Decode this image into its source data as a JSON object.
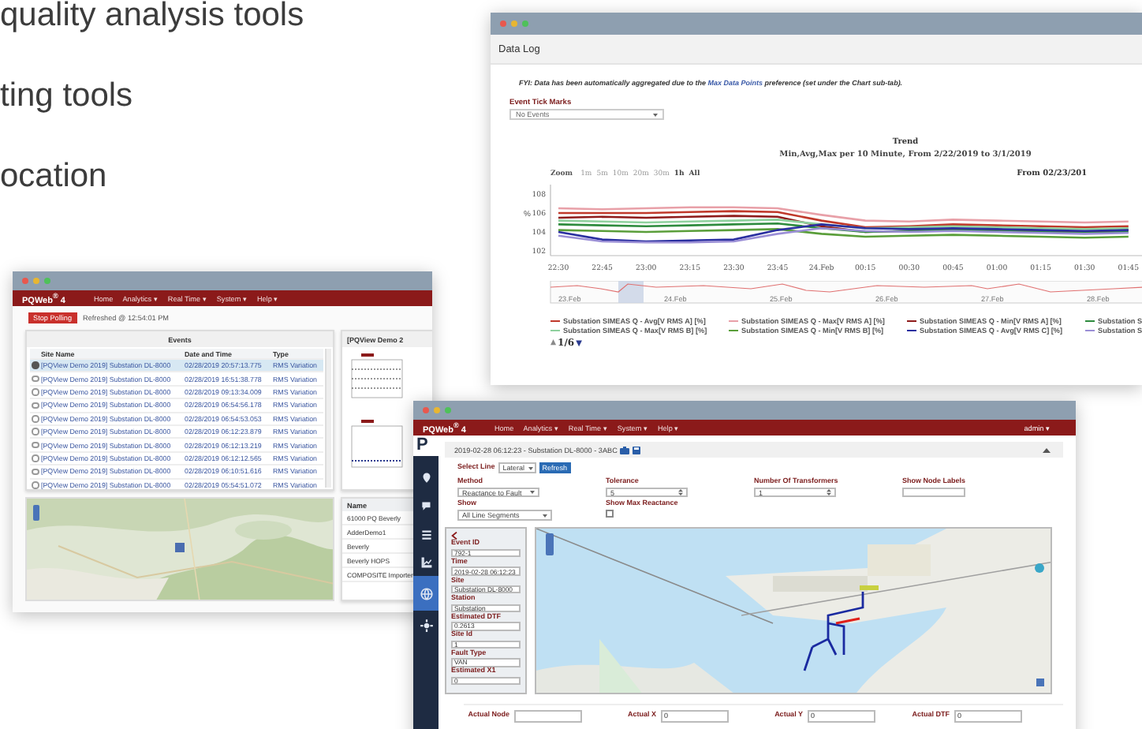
{
  "intro_lines": [
    "quality analysis tools",
    "ting tools",
    "ocation"
  ],
  "data_log": {
    "title": "Data Log",
    "notice": {
      "before": "FYI: Data has been automatically aggregated due to the ",
      "link": "Max Data Points",
      "after": " preference (set under the Chart sub-tab)."
    },
    "tick_marks": {
      "label": "Event Tick Marks",
      "value": "No Events"
    },
    "chart_title": "Trend",
    "chart_subtitle": "Min,Avg,Max per 10 Minute, From 2/22/2019 to 3/1/2019",
    "zoom_label": "Zoom",
    "zoom_options": [
      {
        "label": "1m",
        "disabled": true
      },
      {
        "label": "5m",
        "disabled": true
      },
      {
        "label": "10m",
        "disabled": true
      },
      {
        "label": "20m",
        "disabled": true
      },
      {
        "label": "30m",
        "disabled": true
      },
      {
        "label": "1h",
        "disabled": false
      },
      {
        "label": "All",
        "disabled": false
      }
    ],
    "range_from": "From 02/23/201",
    "chart_data": {
      "type": "line",
      "ylabel": "%",
      "categories": [
        "22:30",
        "22:45",
        "23:00",
        "23:15",
        "23:30",
        "23:45",
        "24.Feb",
        "00:15",
        "00:30",
        "00:45",
        "01:00",
        "01:15",
        "01:30",
        "01:45"
      ],
      "yticks": [
        102,
        104,
        106,
        108
      ],
      "ylim": [
        101.5,
        109
      ],
      "series": [
        {
          "name": "Substation SIMEAS Q - Avg[V RMS A] [%]",
          "color": "#c0392b",
          "values": [
            106,
            106,
            106,
            106.1,
            106.2,
            106.1,
            105.2,
            104.5,
            104.6,
            104.8,
            104.7,
            104.6,
            104.5,
            104.6
          ]
        },
        {
          "name": "Substation SIMEAS Q - Max[V RMS A] [%]",
          "color": "#e8a0a8",
          "values": [
            106.5,
            106.4,
            106.5,
            106.6,
            106.6,
            106.5,
            105.8,
            105.2,
            105.1,
            105.3,
            105.2,
            105.1,
            105,
            105.1
          ]
        },
        {
          "name": "Substation SIMEAS Q - Min[V RMS A] [%]",
          "color": "#8e1b1b",
          "values": [
            105.5,
            105.6,
            105.5,
            105.6,
            105.7,
            105.6,
            104.6,
            104,
            104.1,
            104.3,
            104.2,
            104.1,
            104,
            104.2
          ]
        },
        {
          "name": "Substation S",
          "color": "#2e8b3e",
          "values": [
            104.8,
            104.7,
            104.6,
            104.7,
            104.8,
            104.9,
            104.4,
            104,
            104.1,
            104.2,
            104.1,
            104,
            103.9,
            104
          ]
        },
        {
          "name": "Substation SIMEAS Q - Max[V RMS B] [%]",
          "color": "#8fd19e",
          "values": [
            105.2,
            105.1,
            105,
            105.1,
            105.2,
            105.3,
            104.8,
            104.4,
            104.5,
            104.6,
            104.5,
            104.4,
            104.3,
            104.4
          ]
        },
        {
          "name": "Substation SIMEAS Q - Min[V RMS B] [%]",
          "color": "#5a9e3a",
          "values": [
            104.2,
            104.1,
            104,
            104.1,
            104.2,
            104.3,
            103.8,
            103.5,
            103.6,
            103.7,
            103.6,
            103.5,
            103.4,
            103.5
          ]
        },
        {
          "name": "Substation SIMEAS Q - Avg[V RMS C] [%]",
          "color": "#2a2fa0",
          "values": [
            104,
            103.2,
            103,
            103.1,
            103.2,
            104.2,
            104.8,
            104.4,
            104.3,
            104.4,
            104.3,
            104.2,
            104.1,
            104.2
          ]
        },
        {
          "name": "Substation S",
          "color": "#9b8fd6",
          "values": [
            103.6,
            103,
            102.9,
            102.9,
            103,
            103.8,
            104.4,
            104.1,
            104,
            104.1,
            104,
            103.9,
            103.8,
            103.9
          ]
        }
      ]
    },
    "navigator_labels": [
      "23.Feb",
      "24.Feb",
      "25.Feb",
      "26.Feb",
      "27.Feb",
      "28.Feb"
    ],
    "legend_pager": {
      "up": "▲",
      "up_disabled": true,
      "page": "1/6",
      "down": "▼"
    }
  },
  "events_app": {
    "brand": "PQWeb$^{®}$ 4",
    "menu": [
      "Home",
      "Analytics ▾",
      "Real Time ▾",
      "System ▾",
      "Help ▾"
    ],
    "stop_button": "Stop Polling",
    "refreshed": "Refreshed @ 12:54:01 PM",
    "events_panel": {
      "title": "Events",
      "columns": [
        "Site Name",
        "Date and Time",
        "Type"
      ],
      "rows": [
        {
          "selected": true,
          "site": "[PQView Demo 2019] Substation DL-8000",
          "time": "02/28/2019 20:57:13.775",
          "type": "RMS Variation"
        },
        {
          "selected": false,
          "site": "[PQView Demo 2019] Substation DL-8000",
          "time": "02/28/2019 16:51:38.778",
          "type": "RMS Variation"
        },
        {
          "selected": false,
          "site": "[PQView Demo 2019] Substation DL-8000",
          "time": "02/28/2019 09:13:34.009",
          "type": "RMS Variation"
        },
        {
          "selected": false,
          "site": "[PQView Demo 2019] Substation DL-8000",
          "time": "02/28/2019 06:54:56.178",
          "type": "RMS Variation"
        },
        {
          "selected": false,
          "site": "[PQView Demo 2019] Substation DL-8000",
          "time": "02/28/2019 06:54:53.053",
          "type": "RMS Variation"
        },
        {
          "selected": false,
          "site": "[PQView Demo 2019] Substation DL-8000",
          "time": "02/28/2019 06:12:23.879",
          "type": "RMS Variation"
        },
        {
          "selected": false,
          "site": "[PQView Demo 2019] Substation DL-8000",
          "time": "02/28/2019 06:12:13.219",
          "type": "RMS Variation"
        },
        {
          "selected": false,
          "site": "[PQView Demo 2019] Substation DL-8000",
          "time": "02/28/2019 06:12:12.565",
          "type": "RMS Variation"
        },
        {
          "selected": false,
          "site": "[PQView Demo 2019] Substation DL-8000",
          "time": "02/28/2019 06:10:51.616",
          "type": "RMS Variation"
        },
        {
          "selected": false,
          "site": "[PQView Demo 2019] Substation DL-8000",
          "time": "02/28/2019 05:54:51.072",
          "type": "RMS Variation"
        }
      ]
    },
    "detail_title": "[PQView Demo 2",
    "sites_panel": {
      "column": "Name",
      "rows": [
        "61000 PQ Beverly",
        "AdderDemo1",
        "Beverly",
        "Beverly HOPS",
        "COMPOSITE Importer"
      ]
    }
  },
  "fault_app": {
    "brand": "PQWeb$^{®}$ 4",
    "menu": [
      "Home",
      "Analytics ▾",
      "Real Time ▾",
      "System ▾",
      "Help ▾"
    ],
    "user": "admin ▾",
    "logo": "P",
    "sidebar": [
      {
        "selected": false
      },
      {
        "selected": false
      },
      {
        "selected": false
      },
      {
        "selected": false
      },
      {
        "selected": true
      },
      {
        "selected": false
      }
    ],
    "breadcrumb": "2019-02-28 06:12:23 - Substation DL-8000 - 3ABC",
    "select_line": {
      "label": "Select Line",
      "value": "Lateral",
      "button": "Refresh"
    },
    "options": [
      {
        "label": "Method",
        "kind": "select",
        "value": "Reactance to Fault"
      },
      {
        "label": "Tolerance",
        "kind": "spinner",
        "value": "5"
      },
      {
        "label": "Number Of Transformers",
        "kind": "spinner",
        "value": "1"
      },
      {
        "label": "Show Node Labels",
        "kind": "text"
      },
      {
        "label": "Show",
        "kind": "select",
        "value": "All Line Segments"
      },
      {
        "label": "Show Max Reactance",
        "kind": "checkbox",
        "checked": false
      }
    ],
    "event_fields": [
      {
        "label": "Event ID",
        "value": "792-1"
      },
      {
        "label": "Time",
        "value": "2019-02-28 06:12:23"
      },
      {
        "label": "Site",
        "value": "Substation DL-8000"
      },
      {
        "label": "Station",
        "value": "Substation"
      },
      {
        "label": "Estimated DTF",
        "value": "0.2613"
      },
      {
        "label": "Site Id",
        "value": "1"
      },
      {
        "label": "Fault Type",
        "value": "VAN"
      },
      {
        "label": "Estimated X1",
        "value": "0"
      }
    ],
    "actual_fields": [
      {
        "label": "Actual Node"
      },
      {
        "label": "Actual X",
        "value": "0"
      },
      {
        "label": "Actual Y",
        "value": "0"
      },
      {
        "label": "Actual DTF",
        "value": "0"
      }
    ]
  }
}
